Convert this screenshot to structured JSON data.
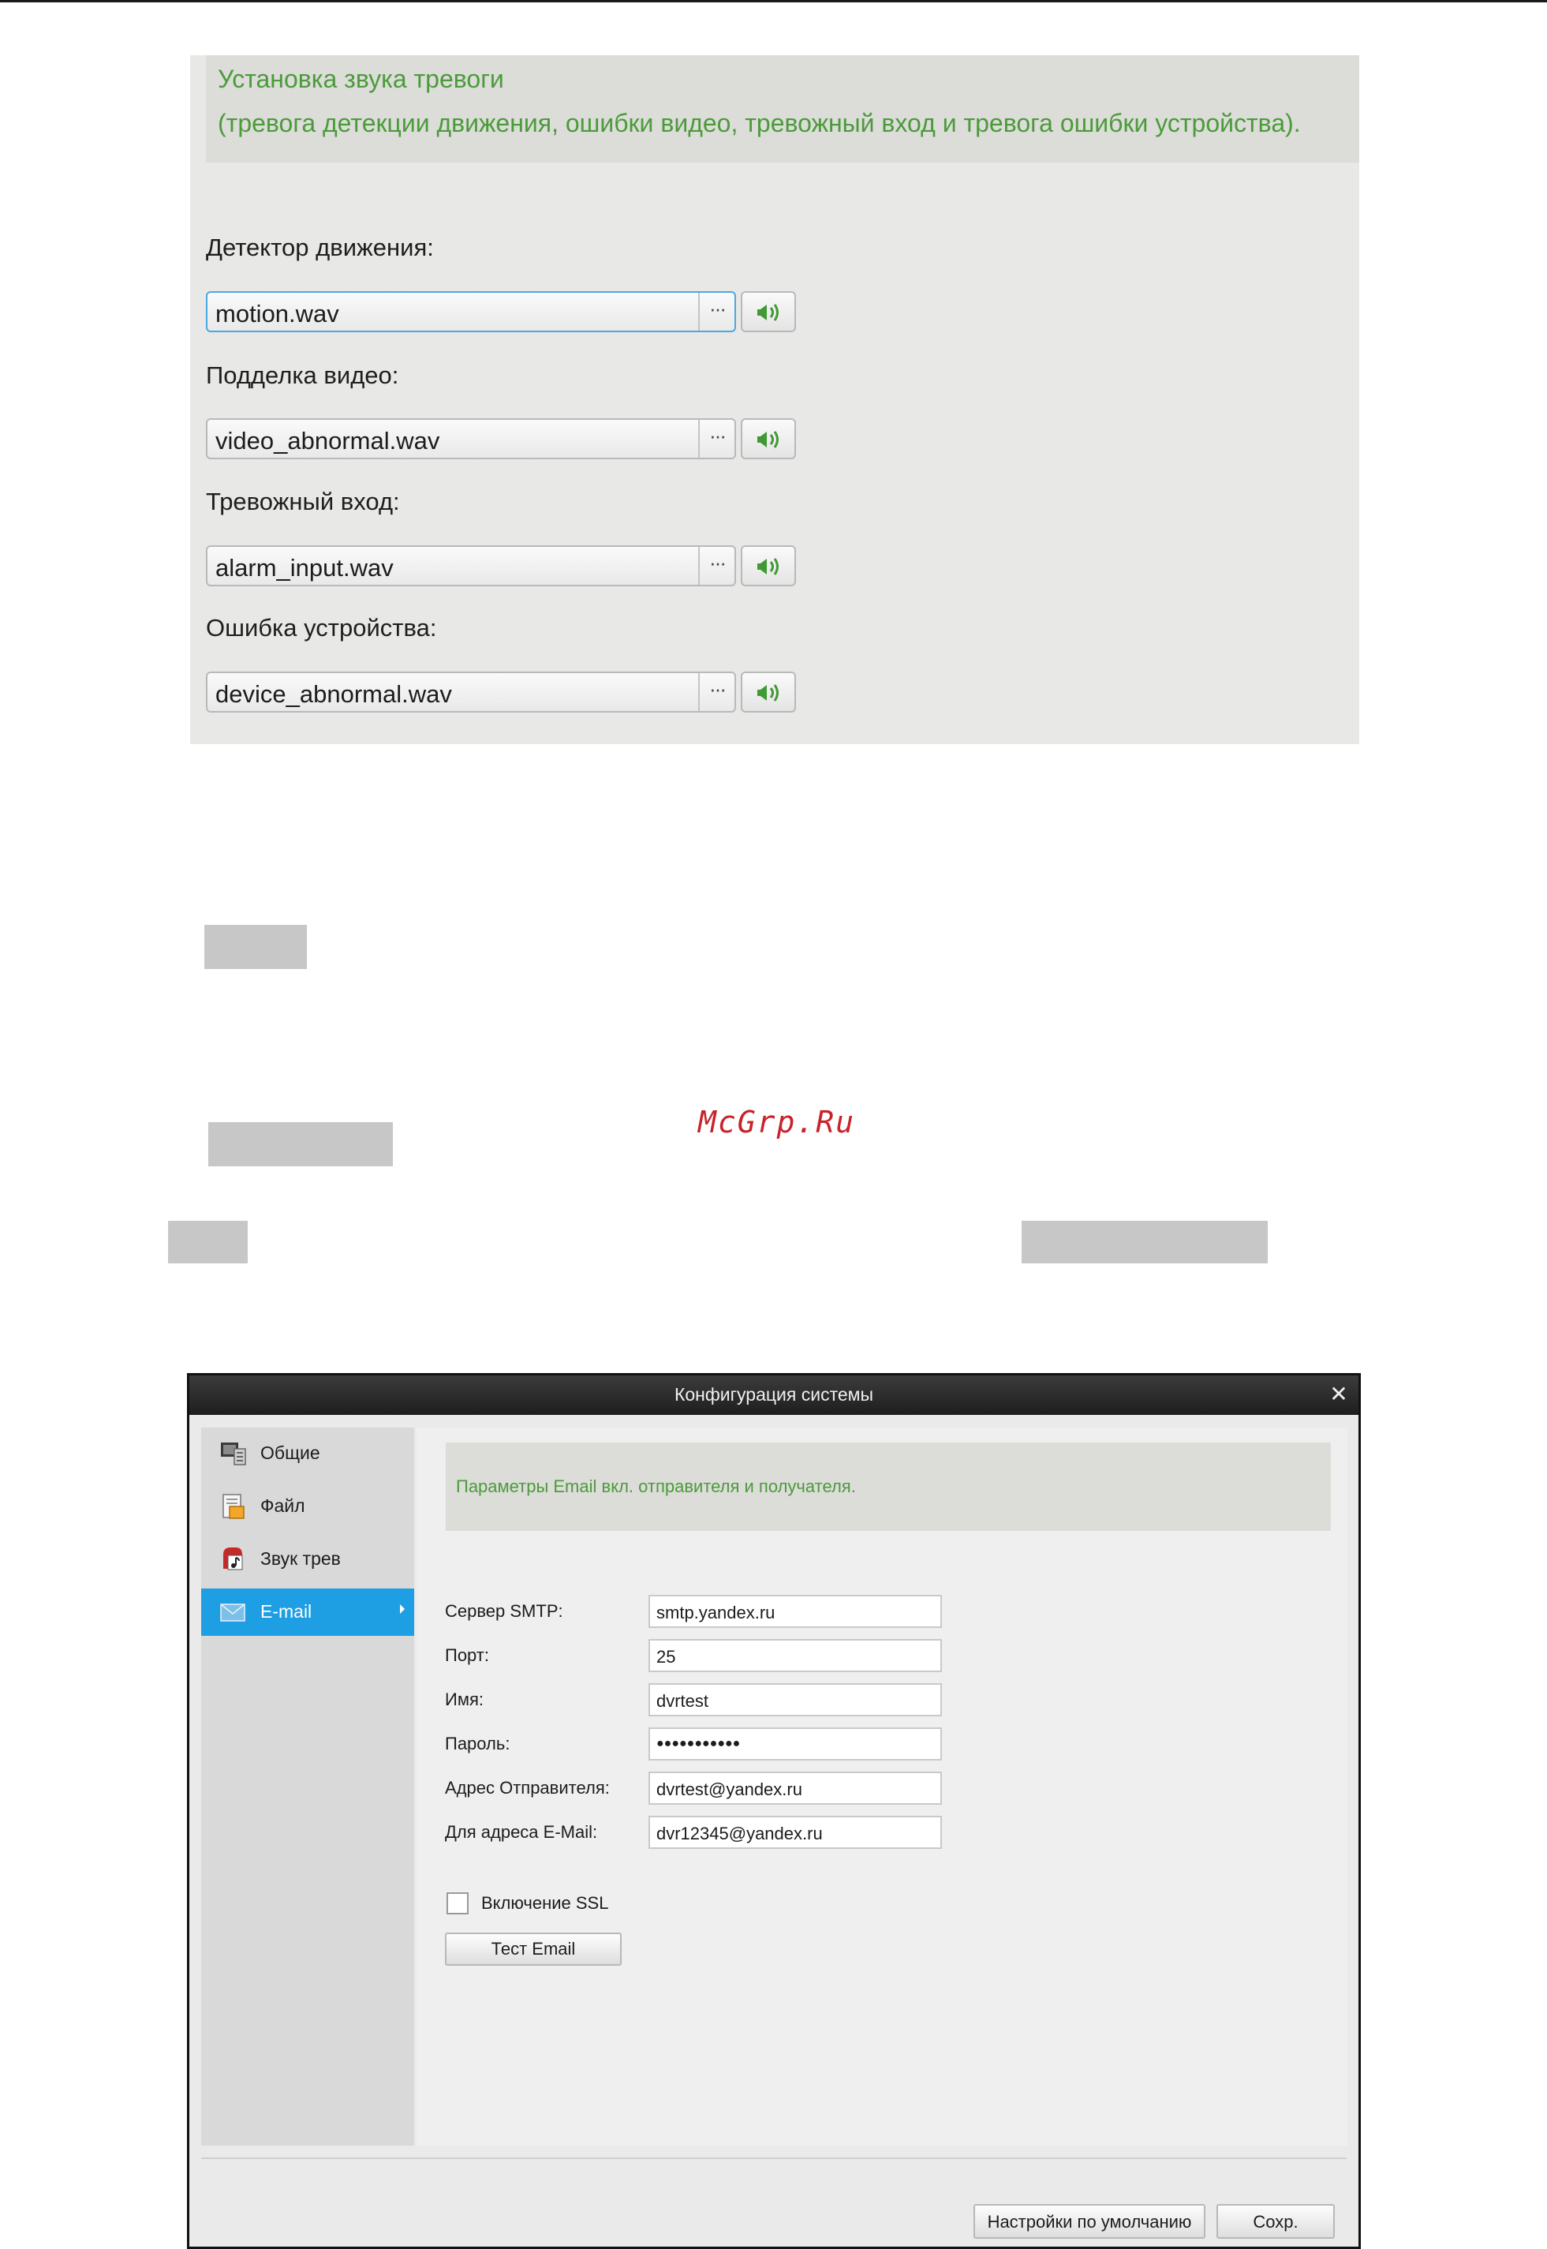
{
  "alarm_sounds": {
    "header_line1": "Установка звука тревоги",
    "header_line2": "(тревога детекции движения, ошибки видео, тревожный вход и тревога ошибки устройства).",
    "rows": [
      {
        "label": "Детектор движения:",
        "file": "motion.wav"
      },
      {
        "label": "Подделка видео:",
        "file": "video_abnormal.wav"
      },
      {
        "label": "Тревожный вход:",
        "file": "alarm_input.wav"
      },
      {
        "label": "Ошибка устройства:",
        "file": "device_abnormal.wav"
      }
    ],
    "browse_glyph": "···"
  },
  "watermark": "McGrp.Ru",
  "dialog": {
    "title": "Конфигурация системы",
    "close_glyph": "✕",
    "sidebar": [
      {
        "label": "Общие",
        "icon": "general-settings-icon"
      },
      {
        "label": "Файл",
        "icon": "file-icon"
      },
      {
        "label": "Звук трев",
        "icon": "alarm-sound-icon"
      },
      {
        "label": "E-mail",
        "icon": "email-icon",
        "active": true
      }
    ],
    "header": "Параметры Email вкл. отправителя и получателя.",
    "fields": [
      {
        "label": "Сервер SMTP:",
        "value": "smtp.yandex.ru"
      },
      {
        "label": "Порт:",
        "value": "25"
      },
      {
        "label": "Имя:",
        "value": "dvrtest"
      },
      {
        "label": "Пароль:",
        "value": "●●●●●●●●●●●"
      },
      {
        "label": "Адрес Отправителя:",
        "value": "dvrtest@yandex.ru"
      },
      {
        "label": "Для адреса E-Mail:",
        "value": "dvr12345@yandex.ru"
      }
    ],
    "ssl_label": "Включение SSL",
    "test_button": "Тест Email",
    "defaults_button": "Настройки по умолчанию",
    "save_button": "Сохр."
  },
  "colors": {
    "accent_green": "#4b9b3a",
    "nav_active": "#1f9fe3",
    "watermark_red": "#c8222a"
  }
}
